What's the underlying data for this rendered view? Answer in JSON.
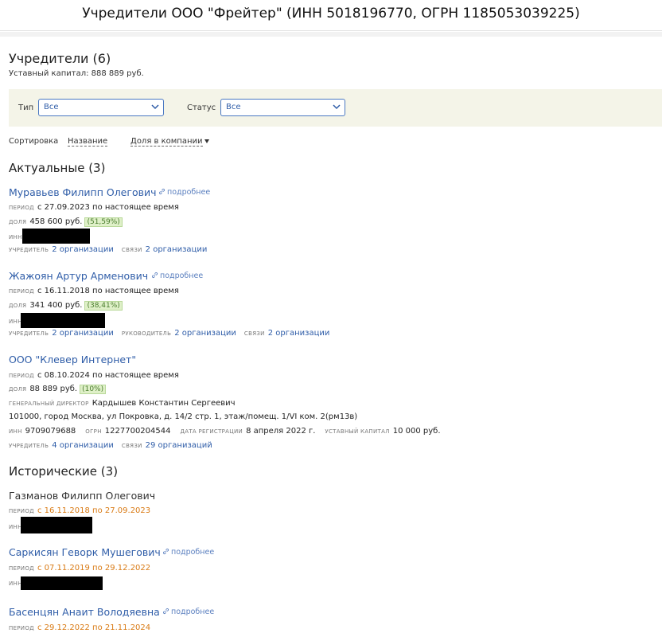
{
  "window": {
    "title": "Учредители ООО \"Фрейтер\" (ИНН 5018196770, ОГРН 1185053039225)"
  },
  "header": {
    "title": "Учредители (6)",
    "capital": "Уставный капитал: 888 889 руб."
  },
  "filters": {
    "type_label": "Тип",
    "type_value": "Все",
    "status_label": "Статус",
    "status_value": "Все"
  },
  "sort": {
    "label": "Сортировка",
    "by_name": "Название",
    "by_share": "Доля в компании"
  },
  "labels": {
    "period": "ПЕРИОД",
    "share": "ДОЛЯ",
    "inn": "ИНН",
    "founder": "УЧРЕДИТЕЛЬ",
    "links": "СВЯЗИ",
    "head": "РУКОВОДИТЕЛЬ",
    "gen_director": "ГЕНЕРАЛЬНЫЙ ДИРЕКТОР",
    "ogrn": "ОГРН",
    "reg_date": "ДАТА РЕГИСТРАЦИИ",
    "charter_capital": "УСТАВНЫЙ КАПИТАЛ",
    "more": "подробнее"
  },
  "current": {
    "heading": "Актуальные (3)",
    "items": [
      {
        "name": "Муравьев Филипп Олегович",
        "period": "с 27.09.2023 по настоящее время",
        "share": "458 600 руб.",
        "share_pct": "(51,59%)",
        "founder_link": "2 организации",
        "links_link": "2 организации"
      },
      {
        "name": "Жажоян Артур Арменович",
        "period": "с 16.11.2018 по настоящее время",
        "share": "341 400 руб.",
        "share_pct": "(38,41%)",
        "founder_link": "2 организации",
        "head_link": "2 организации",
        "links_link": "2 организации"
      },
      {
        "name": "ООО \"Клевер Интернет\"",
        "period": "с 08.10.2024 по настоящее время",
        "share": "88 889 руб.",
        "share_pct": "(10%)",
        "director": "Кардышев Константин Сергеевич",
        "address": "101000, город Москва, ул Покровка, д. 14/2 стр. 1, этаж/помещ. 1/VI ком. 2(рм13в)",
        "inn": "9709079688",
        "ogrn": "1227700204544",
        "reg_date": "8 апреля 2022 г.",
        "capital": "10 000 руб.",
        "founder_link": "4 организации",
        "links_link": "29 организаций"
      }
    ]
  },
  "historical": {
    "heading": "Исторические (3)",
    "items": [
      {
        "name": "Газманов Филипп Олегович",
        "period": "с 16.11.2018 по 27.09.2023"
      },
      {
        "name": "Саркисян Геворк Мушегович",
        "period": "с 07.11.2019 по 29.12.2022"
      },
      {
        "name": "Басенцян Анаит Володяевна",
        "period": "с 29.12.2022 по 21.11.2024"
      }
    ]
  }
}
